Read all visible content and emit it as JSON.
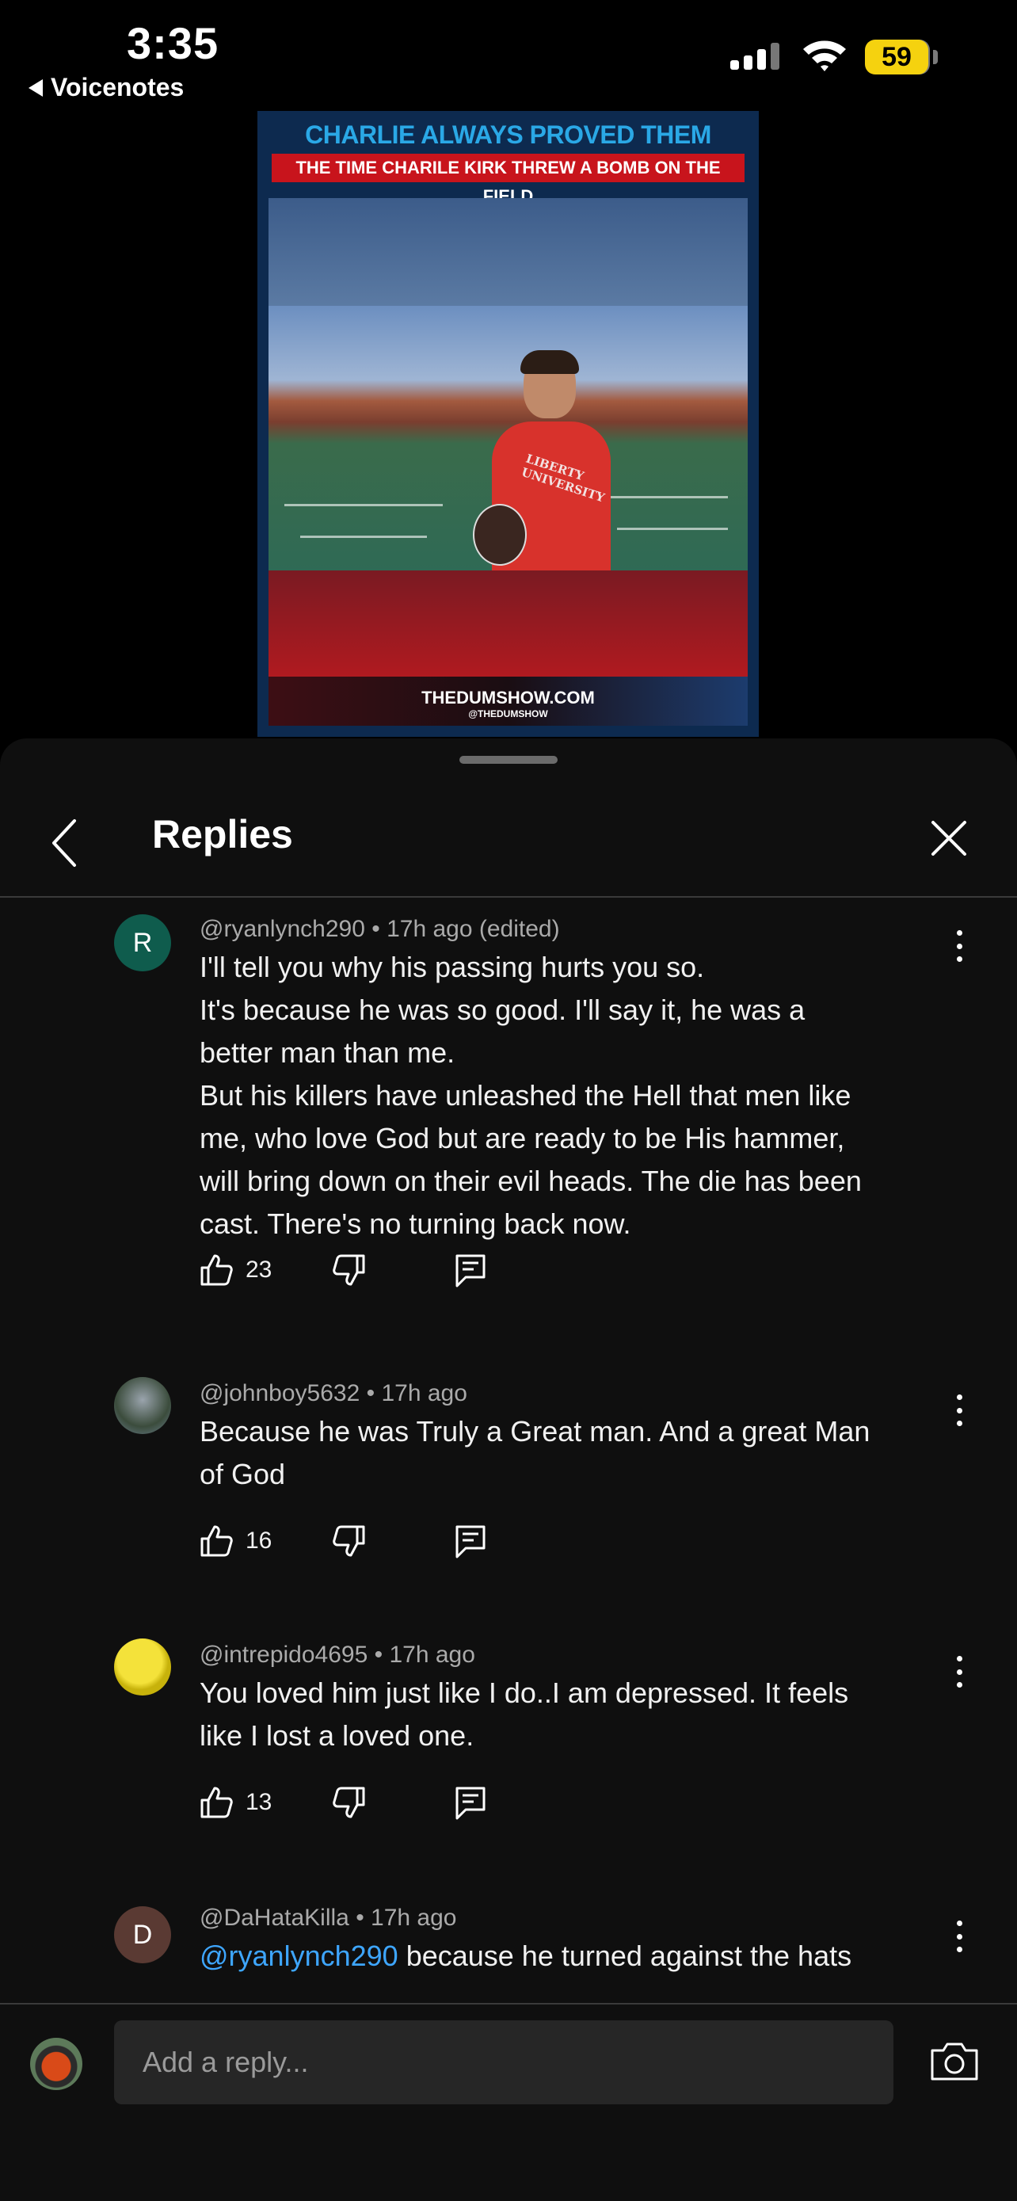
{
  "status_bar": {
    "time": "3:35",
    "back_app": "Voicenotes",
    "battery": "59"
  },
  "video": {
    "title": "CHARLIE ALWAYS PROVED THEM WRONG",
    "subtitle": "THE TIME CHARILE KIRK THREW A BOMB ON THE FIELD",
    "shirt_text": "LIBERTY UNIVERSITY",
    "brand": "THEDUMSHOW.COM",
    "handle": "@THEDUMSHOW"
  },
  "header": {
    "title": "Replies"
  },
  "comments": [
    {
      "avatar_letter": "R",
      "avatar_color": "#0f5c4d",
      "meta": "@ryanlynch290 • 17h ago (edited)",
      "text": "I'll tell you why his passing hurts you so.\nIt's because he was so good. I'll say it, he was a\nbetter man than me.\nBut his killers have unleashed the Hell that men like\nme, who love God but are ready to be His hammer,\nwill bring down on their evil heads. The die has been\ncast. There's no turning back now.",
      "likes": "23"
    },
    {
      "avatar_letter": "",
      "meta": "@johnboy5632 • 17h ago",
      "text": "Because he was Truly a Great man. And  a great Man\nof God",
      "likes": "16"
    },
    {
      "avatar_letter": "",
      "meta": "@intrepido4695 • 17h ago",
      "text": "You loved him just like I do..I am depressed. It feels\nlike I lost a loved one.",
      "likes": "13"
    },
    {
      "avatar_letter": "D",
      "avatar_color": "#5a3a33",
      "meta": "@DaHataKilla • 17h ago",
      "mention": "@ryanlynch290",
      "text": " because he turned against the hats"
    }
  ],
  "reply_bar": {
    "placeholder": "Add a reply..."
  },
  "icons": {
    "back": "chevron-left-icon",
    "close": "close-icon",
    "more": "more-vertical-icon",
    "like": "thumbs-up-icon",
    "dislike": "thumbs-down-icon",
    "reply": "comment-icon",
    "camera": "camera-icon"
  }
}
